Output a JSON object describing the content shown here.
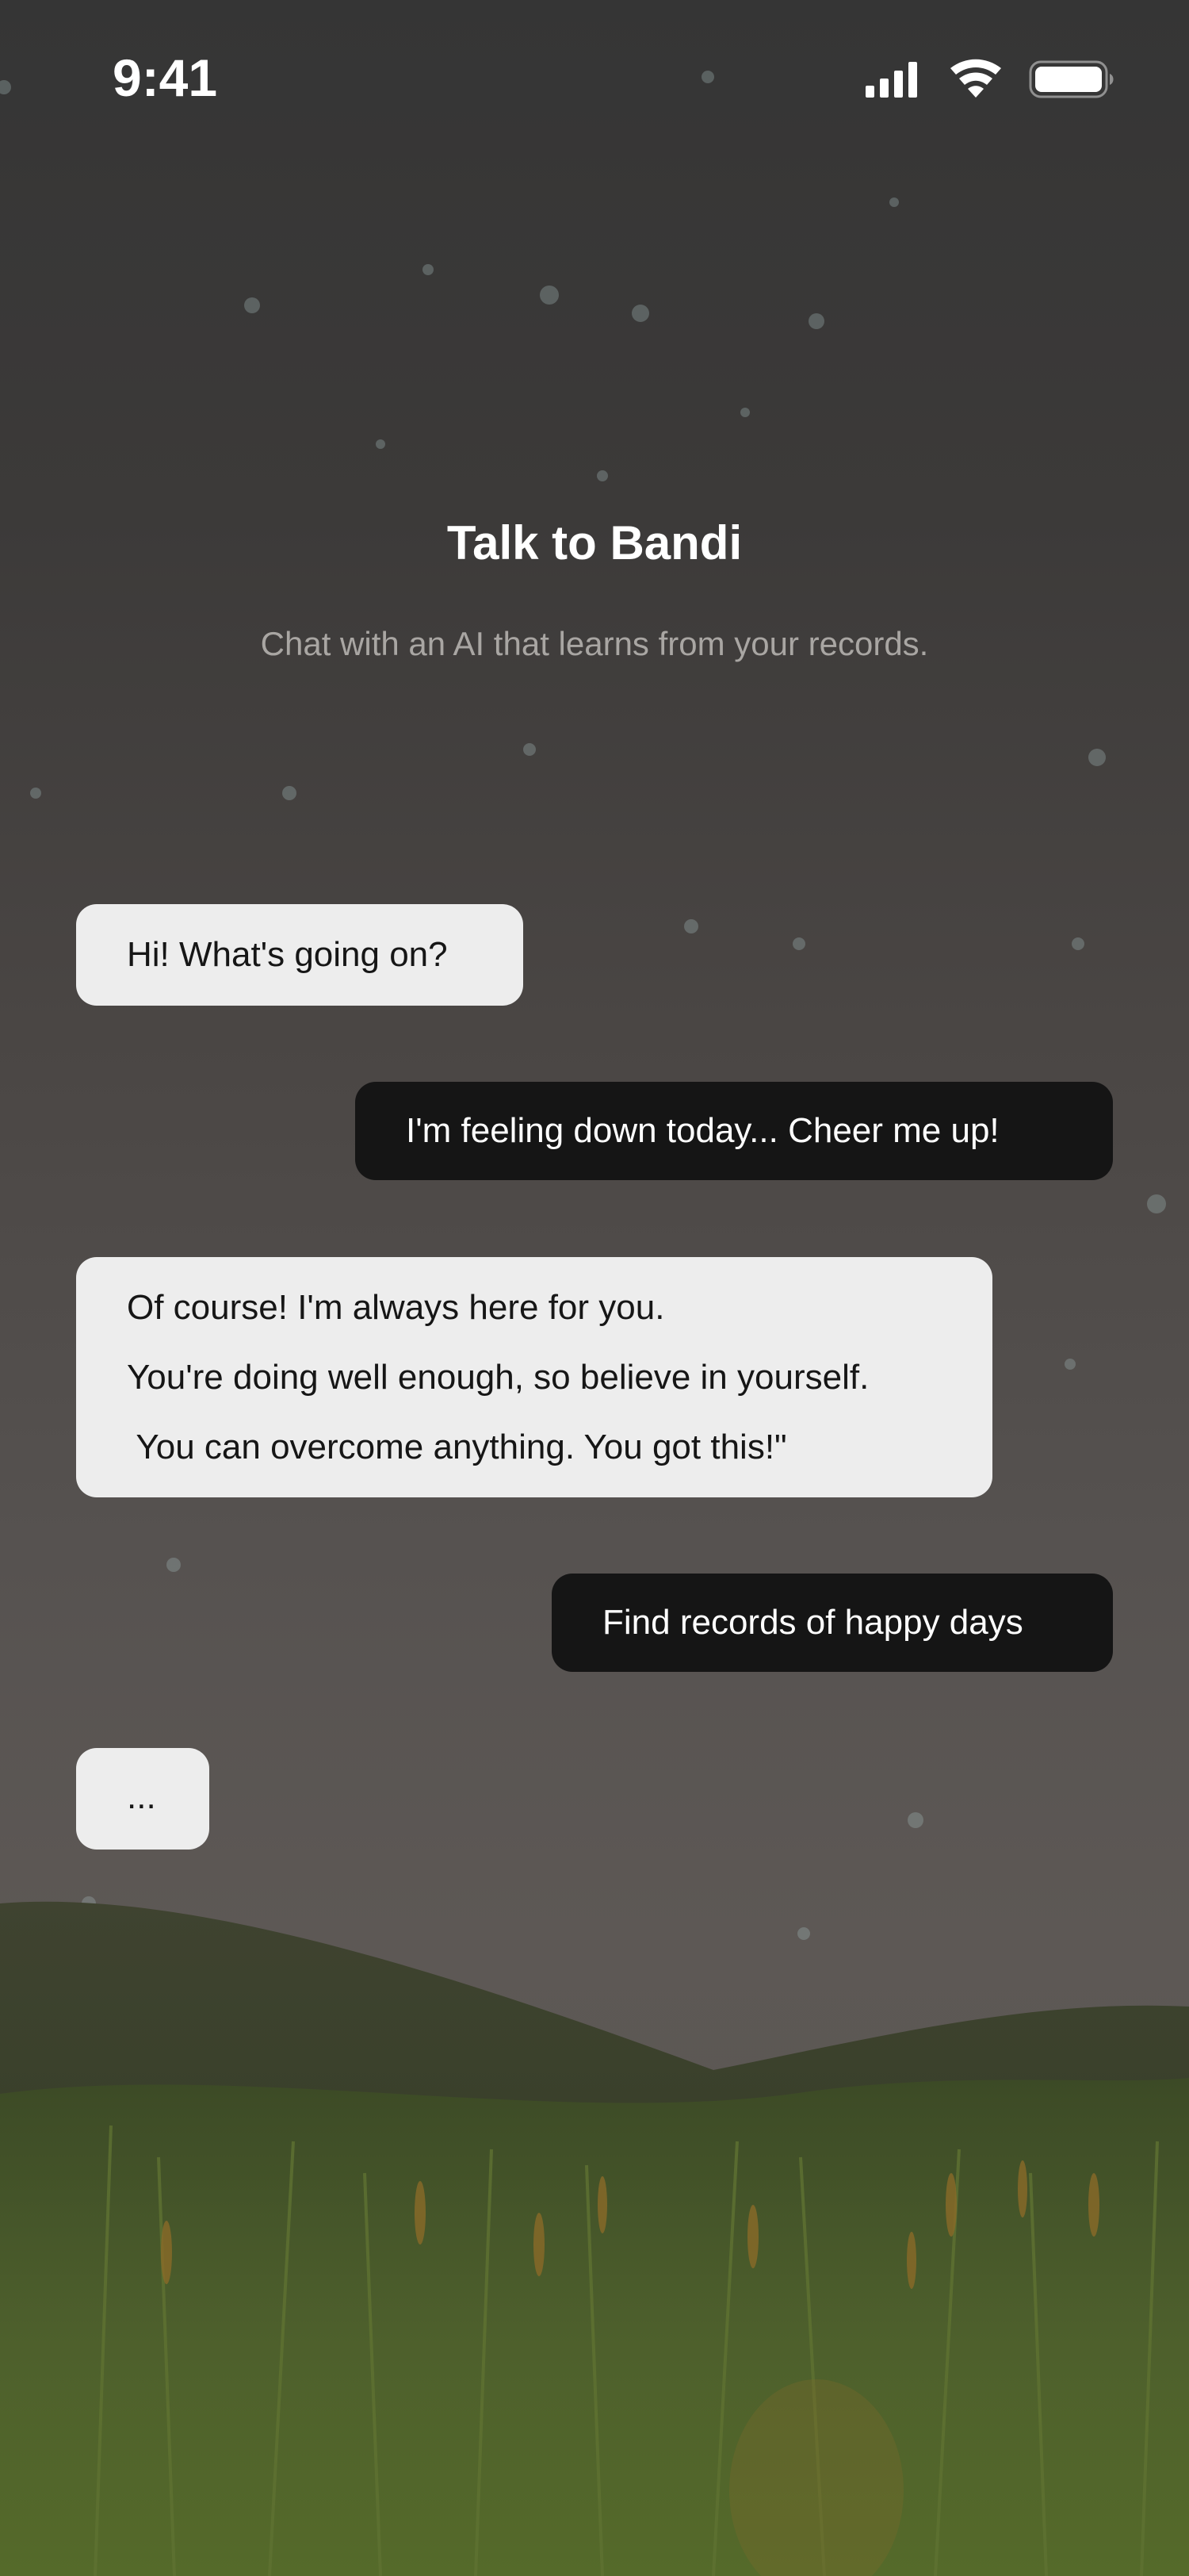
{
  "status_bar": {
    "time": "9:41",
    "icons": [
      "cellular-signal-icon",
      "wifi-icon",
      "battery-icon"
    ]
  },
  "header": {
    "title": "Talk to Bandi",
    "subtitle": "Chat with an AI that learns from your records."
  },
  "chat": {
    "messages": [
      {
        "sender": "bot",
        "lines": [
          "Hi! What's going on?"
        ]
      },
      {
        "sender": "user",
        "lines": [
          "I'm feeling down today... Cheer me up!"
        ]
      },
      {
        "sender": "bot",
        "lines": [
          "Of course! I'm always here for you.",
          "You're doing well enough, so believe in yourself.",
          " You can overcome anything. You got this!\""
        ]
      },
      {
        "sender": "user",
        "lines": [
          "Find records of happy days"
        ]
      },
      {
        "sender": "bot",
        "lines": [
          "..."
        ]
      }
    ]
  },
  "colors": {
    "bot_bubble": "#ededed",
    "user_bubble": "#151515",
    "title_text": "#ffffff",
    "subtitle_text": "#a9a6a3"
  }
}
